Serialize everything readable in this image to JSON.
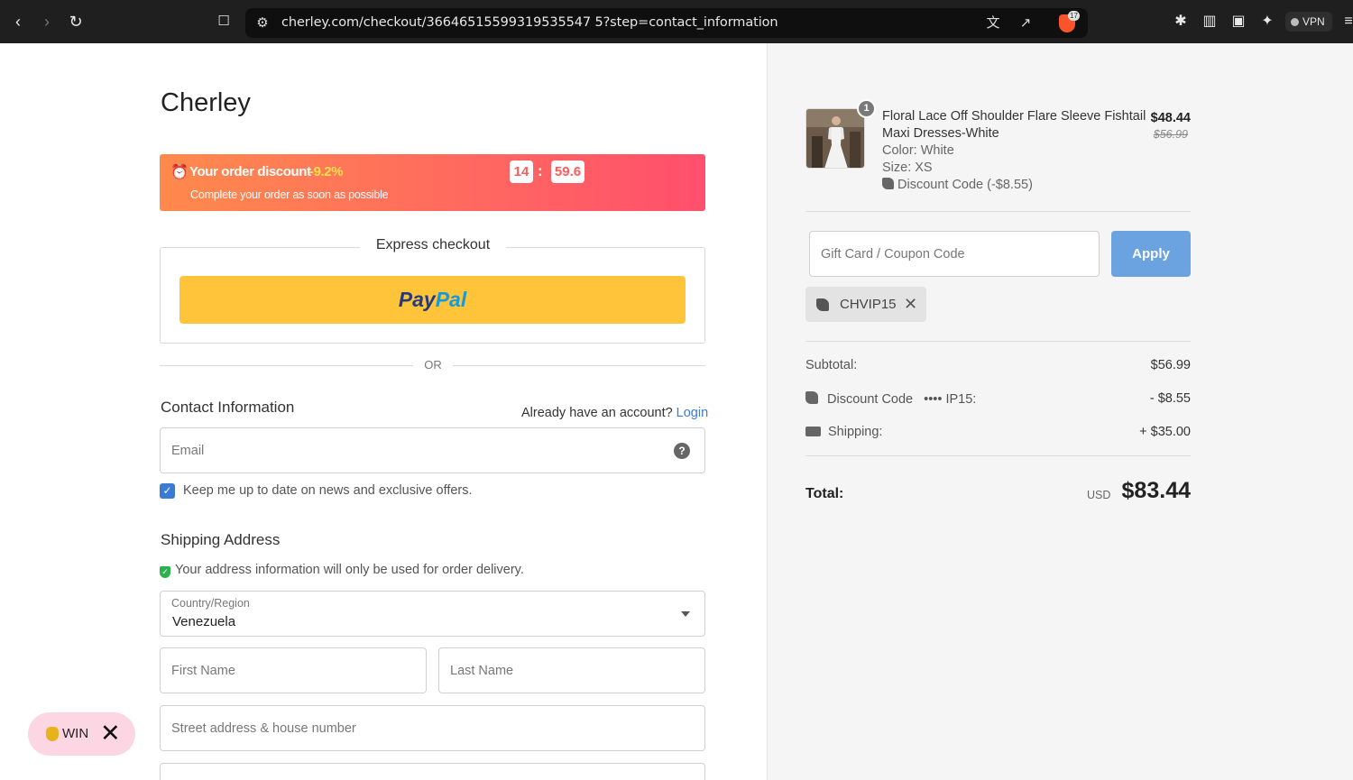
{
  "browser": {
    "url": "cherley.com/checkout/36646515599319535547 5?step=contact_information",
    "brave_badge": "17",
    "vpn_label": "VPN"
  },
  "brand": "Cherley",
  "discount_banner": {
    "title": "Your order discount",
    "percent": "-9.2%",
    "timer_minutes": "14",
    "timer_sep": ":",
    "timer_seconds": "59.6",
    "subtitle": "Complete your order as soon as possible"
  },
  "express": {
    "label": "Express checkout",
    "paypal_part1": "Pay",
    "paypal_part2": "Pal",
    "or_text": "OR"
  },
  "contact": {
    "title": "Contact Information",
    "account_prompt": "Already have an account?",
    "login_label": "Login",
    "email_placeholder": "Email",
    "newsletter_label": "Keep me up to date on news and exclusive offers."
  },
  "shipping": {
    "title": "Shipping Address",
    "note": "Your address information will only be used for order delivery.",
    "country_label": "Country/Region",
    "country_value": "Venezuela",
    "first_name_placeholder": "First Name",
    "last_name_placeholder": "Last Name",
    "street_placeholder": "Street address & house number"
  },
  "win_badge": {
    "label": "WIN"
  },
  "order": {
    "quantity": "1",
    "product_name_line1": "Floral Lace Off Shoulder Flare Sleeve Fishtail",
    "product_name_line2": "Maxi Dresses-White",
    "color": "Color: White",
    "size": "Size: XS",
    "discount_line": "Discount Code (-$8.55)",
    "price": "$48.44",
    "original_price": "$56.99",
    "coupon_placeholder": "Gift Card / Coupon Code",
    "apply_label": "Apply",
    "applied_code": "CHVIP15",
    "subtotal_label": "Subtotal:",
    "subtotal_value": "$56.99",
    "discount_label": "Discount Code",
    "discount_code_masked": "•••• IP15:",
    "discount_value": "- $8.55",
    "shipping_label": "Shipping:",
    "shipping_value": "+ $35.00",
    "total_label": "Total:",
    "total_currency": "USD",
    "total_value": "$83.44"
  },
  "colors": {
    "accent_blue": "#3a7bd5",
    "paypal_yellow": "#ffc439",
    "banner_start": "#ff8a4c",
    "banner_end": "#ff4f6c"
  }
}
